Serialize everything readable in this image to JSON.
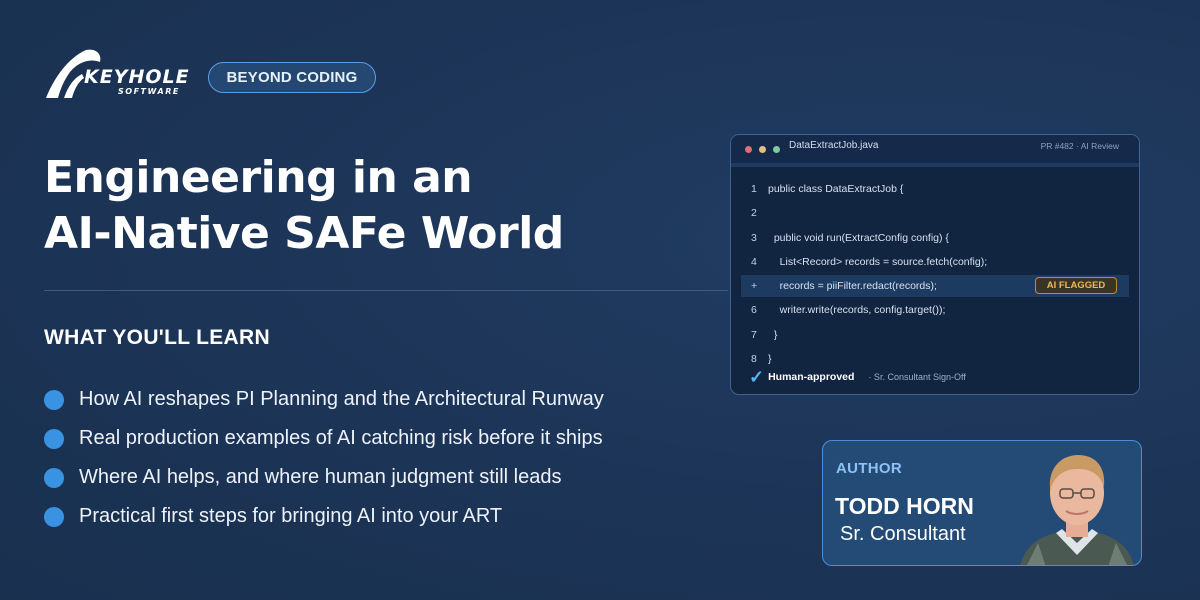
{
  "brand": {
    "logo_word": "KEYHOLE",
    "logo_sub": "SOFTWARE",
    "tag": "BEYOND CODING"
  },
  "title_lines": [
    "Engineering in an",
    "AI-Native SAFe World"
  ],
  "learn": {
    "heading": "WHAT YOU'LL LEARN",
    "items": [
      "How AI reshapes PI Planning and the Architectural Runway",
      "Real production examples of AI catching risk before it ships",
      "Where AI helps, and where human judgment still leads",
      "Practical first steps for bringing AI into your ART"
    ]
  },
  "code_window": {
    "filename": "DataExtractJob.java",
    "pr_label": "PR #482 · AI Review",
    "lines": [
      {
        "num": "1",
        "text": "public class DataExtractJob {"
      },
      {
        "num": "2",
        "text": ""
      },
      {
        "num": "3",
        "text": "  public void run(ExtractConfig config) {"
      },
      {
        "num": "4",
        "text": "    List<Record> records = source.fetch(config);"
      },
      {
        "num": "+",
        "text": "    records = piiFilter.redact(records);"
      },
      {
        "num": "6",
        "text": "    writer.write(records, config.target());"
      },
      {
        "num": "7",
        "text": "  }"
      },
      {
        "num": "8",
        "text": "}"
      }
    ],
    "flag_label": "AI FLAGGED",
    "approved_label": "Human-approved",
    "signoff_label": "· Sr. Consultant Sign-Off"
  },
  "author": {
    "tag": "AUTHOR",
    "name": "TODD HORN",
    "role": "Sr. Consultant"
  },
  "colors": {
    "background": "#1c3456",
    "accent": "#3a93e2",
    "flag": "#f0b955"
  }
}
